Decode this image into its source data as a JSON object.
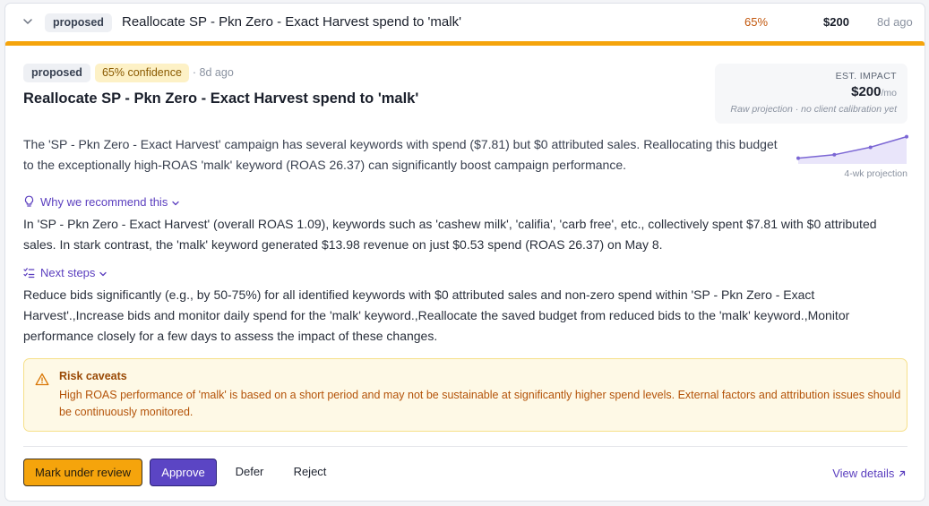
{
  "row": {
    "status": "proposed",
    "title": "Reallocate SP - Pkn Zero - Exact Harvest spend to 'malk'",
    "confidence": "65%",
    "amount": "$200",
    "age": "8d ago"
  },
  "detail": {
    "status": "proposed",
    "confidence_label": "65% confidence",
    "age": "· 8d ago",
    "title": "Reallocate SP - Pkn Zero - Exact Harvest spend to 'malk'",
    "description": "The 'SP - Pkn Zero - Exact Harvest' campaign has several keywords with spend ($7.81) but $0 attributed sales. Reallocating this budget to the exceptionally high-ROAS 'malk' keyword (ROAS 26.37) can significantly boost campaign performance."
  },
  "impact": {
    "label": "EST. IMPACT",
    "value": "$200",
    "unit": "/mo",
    "note": "Raw projection · no client calibration yet",
    "sparkline_label": "4-wk projection",
    "sparkline_points": [
      0.2,
      0.32,
      0.58,
      0.95
    ]
  },
  "why": {
    "label": "Why we recommend this",
    "body": "In 'SP - Pkn Zero - Exact Harvest' (overall ROAS 1.09), keywords such as 'cashew milk', 'califia', 'carb free', etc., collectively spent $7.81 with $0 attributed sales. In stark contrast, the 'malk' keyword generated $13.98 revenue on just $0.53 spend (ROAS 26.37) on May 8."
  },
  "next_steps": {
    "label": "Next steps",
    "body": "Reduce bids significantly (e.g., by 50-75%) for all identified keywords with $0 attributed sales and non-zero spend within 'SP - Pkn Zero - Exact Harvest'.,Increase bids and monitor daily spend for the 'malk' keyword.,Reallocate the saved budget from reduced bids to the 'malk' keyword.,Monitor performance closely for a few days to assess the impact of these changes."
  },
  "risk": {
    "title": "Risk caveats",
    "body": "High ROAS performance of 'malk' is based on a short period and may not be sustainable at significantly higher spend levels. External factors and attribution issues should be continuously monitored."
  },
  "actions": {
    "mark_review": "Mark under review",
    "approve": "Approve",
    "defer": "Defer",
    "reject": "Reject",
    "view_details": "View details"
  },
  "colors": {
    "accent": "#f5a40c",
    "primary": "#5b45c4",
    "link": "#5b3fbf",
    "warning_bg": "#fef9e6"
  }
}
